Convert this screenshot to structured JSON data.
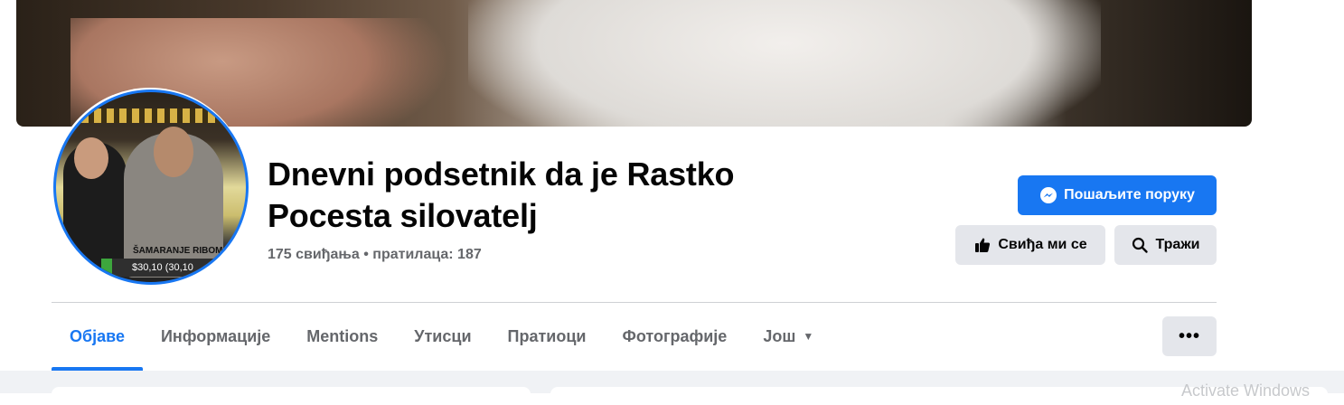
{
  "page": {
    "title": "Dnevni podsetnik da je Rastko Pocesta silovatelj",
    "stats": "175 свиђања • пратилаца: 187"
  },
  "avatar": {
    "caption": "ŠAMARANJE RIBOM",
    "price": "$30,10 (30,10"
  },
  "actions": {
    "message_label": "Пошаљите поруку",
    "like_label": "Свиђа ми се",
    "search_label": "Тражи"
  },
  "tabs": [
    {
      "label": "Објаве"
    },
    {
      "label": "Информације"
    },
    {
      "label": "Mentions"
    },
    {
      "label": "Утисци"
    },
    {
      "label": "Пратиоци"
    },
    {
      "label": "Фотографије"
    },
    {
      "label": "Још"
    }
  ],
  "more_label": "•••",
  "watermark": "Activate Windows",
  "colors": {
    "accent": "#1877f2",
    "secondary_button": "#e4e6eb",
    "muted_text": "#65676b"
  }
}
